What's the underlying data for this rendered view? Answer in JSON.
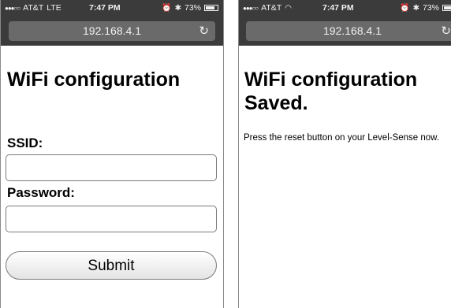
{
  "left": {
    "status": {
      "carrier": "AT&T",
      "network": "LTE",
      "time": "7:47 PM",
      "battery": "73%"
    },
    "url": "192.168.4.1",
    "title": "WiFi configuration",
    "ssid_label": "SSID:",
    "ssid_value": "",
    "password_label": "Password:",
    "password_value": "",
    "submit_label": "Submit"
  },
  "right": {
    "status": {
      "carrier": "AT&T",
      "time": "7:47 PM",
      "battery": "73%"
    },
    "url": "192.168.4.1",
    "title": "WiFi configuration Saved.",
    "message": "Press the reset button on your Level-Sense now."
  },
  "icons": {
    "signal": "signal-dots-icon",
    "wifi": "wifi-icon",
    "alarm": "alarm-icon",
    "bluetooth": "bluetooth-icon",
    "battery": "battery-icon",
    "reload": "reload-icon"
  }
}
